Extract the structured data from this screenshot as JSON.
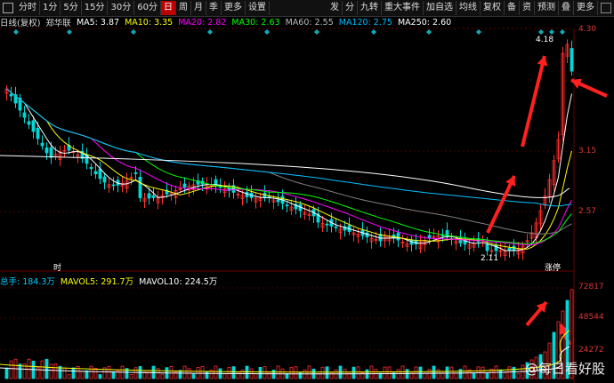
{
  "toolbar": {
    "left_icon": "grid-icon",
    "items": [
      "分时",
      "1分",
      "5分",
      "15分",
      "30分",
      "60分",
      "日",
      "周",
      "月",
      "季",
      "更多",
      "设置"
    ],
    "active": "日",
    "right_items": [
      "发",
      "分",
      "九转",
      "重大事件",
      "加自选",
      "均线",
      "复权",
      "备",
      "资",
      "预测",
      "叠",
      "更多"
    ]
  },
  "info": {
    "period": "日线(复权)",
    "name": "郑华联",
    "ma5": "MA5: 3.87",
    "ma10": "MA10: 3.35",
    "ma20": "MA20: 2.82",
    "ma30": "MA30: 2.63",
    "ma60": "MA60: 2.55",
    "ma120": "MA120: 2.75",
    "ma250": "MA250: 2.60"
  },
  "price_axis": [
    "4.30",
    "3.15",
    "2.57"
  ],
  "annotations": {
    "high": "4.18",
    "low": "2.11",
    "left_bottom": "时",
    "right_bottom": "涨停"
  },
  "volume": {
    "total": "总手: 184.3万",
    "mavol5": "MAVOL5: 291.7万",
    "mavol10": "MAVOL10: 224.5万",
    "axis": [
      "72817",
      "48544",
      "24272"
    ]
  },
  "watermark": "@每日看好股",
  "colors": {
    "up": "#ff3030",
    "down": "#00d8d8",
    "ma5": "#ffffff",
    "ma10": "#ffff00",
    "ma20": "#ff00ff",
    "ma30": "#00ff00",
    "ma60": "#808080",
    "ma120": "#00bfff",
    "ma250": "#ffffff",
    "arrow": "#ff2020"
  }
}
